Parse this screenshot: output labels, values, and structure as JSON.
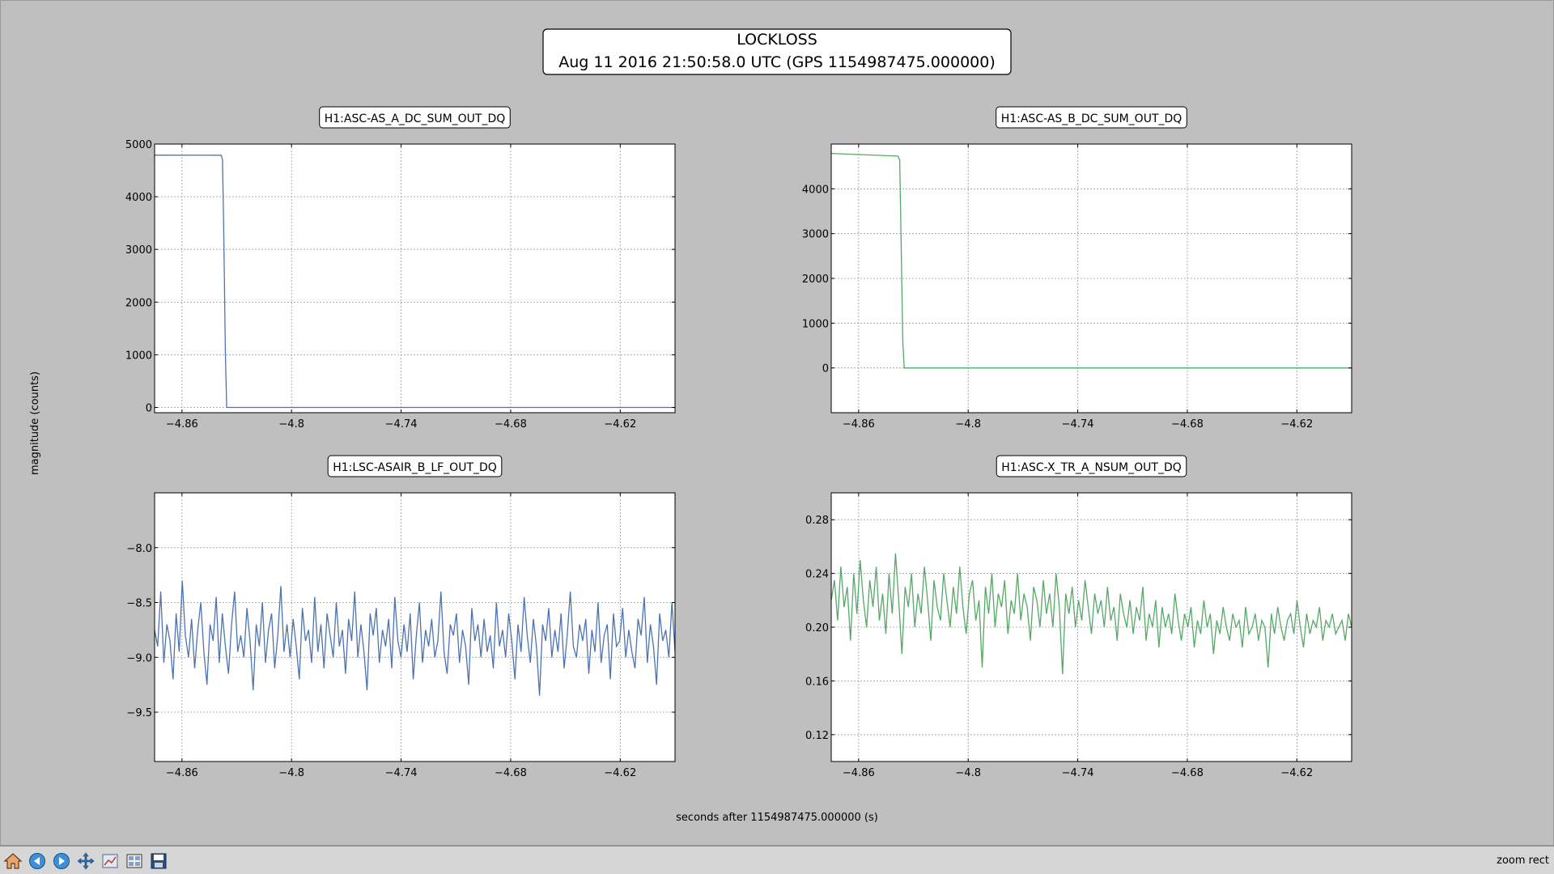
{
  "figure": {
    "title_line1": "LOCKLOSS",
    "title_line2": "Aug 11 2016 21:50:58.0 UTC (GPS 1154987475.000000)",
    "xlabel": "seconds after 1154987475.000000 (s)",
    "ylabel": "magnitude (counts)"
  },
  "toolbar": {
    "buttons": [
      "home-icon",
      "back-icon",
      "forward-icon",
      "pan-icon",
      "subplots-icon",
      "configure-icon",
      "save-icon"
    ],
    "status": "zoom rect"
  },
  "chart_data": [
    {
      "type": "line",
      "title": "H1:ASC-AS_A_DC_SUM_OUT_DQ",
      "xlim": [
        -4.875,
        -4.59
      ],
      "ylim": [
        -100,
        5000
      ],
      "xticks": [
        -4.86,
        -4.8,
        -4.74,
        -4.68,
        -4.62
      ],
      "xtick_labels": [
        "−4.86",
        "−4.8",
        "−4.74",
        "−4.68",
        "−4.62"
      ],
      "yticks": [
        0,
        1000,
        2000,
        3000,
        4000,
        5000
      ],
      "ytick_labels": [
        "0",
        "1000",
        "2000",
        "3000",
        "4000",
        "5000"
      ],
      "grid": true,
      "color": "#4c72b0",
      "series": [
        {
          "x": [
            -4.875,
            -4.8385,
            -4.8378,
            -4.8372,
            -4.8362,
            -4.8355,
            -4.59
          ],
          "y": [
            4790,
            4788,
            4700,
            3500,
            1000,
            0,
            0
          ]
        }
      ]
    },
    {
      "type": "line",
      "title": "H1:ASC-AS_B_DC_SUM_OUT_DQ",
      "xlim": [
        -4.875,
        -4.59
      ],
      "ylim": [
        -1000,
        5000
      ],
      "xticks": [
        -4.86,
        -4.8,
        -4.74,
        -4.68,
        -4.62
      ],
      "xtick_labels": [
        "−4.86",
        "−4.8",
        "−4.74",
        "−4.68",
        "−4.62"
      ],
      "yticks": [
        0,
        1000,
        2000,
        3000,
        4000
      ],
      "ytick_labels": [
        "0",
        "1000",
        "2000",
        "3000",
        "4000"
      ],
      "grid": true,
      "color": "#55a868",
      "series": [
        {
          "x": [
            -4.875,
            -4.8385,
            -4.8375,
            -4.8368,
            -4.8358,
            -4.835,
            -4.59
          ],
          "y": [
            4790,
            4730,
            4650,
            3000,
            600,
            0,
            0
          ]
        }
      ]
    },
    {
      "type": "line",
      "title": "H1:LSC-ASAIR_B_LF_OUT_DQ",
      "xlim": [
        -4.875,
        -4.59
      ],
      "ylim": [
        -9.95,
        -7.5
      ],
      "xticks": [
        -4.86,
        -4.8,
        -4.74,
        -4.68,
        -4.62
      ],
      "xtick_labels": [
        "−4.86",
        "−4.8",
        "−4.74",
        "−4.68",
        "−4.62"
      ],
      "yticks": [
        -9.5,
        -9.0,
        -8.5,
        -8.0
      ],
      "ytick_labels": [
        "−9.5",
        "−9.0",
        "−8.5",
        "−8.0"
      ],
      "grid": true,
      "color": "#4c72b0",
      "series": [
        {
          "x_start": -4.875,
          "x_end": -4.59,
          "y": [
            -8.75,
            -8.9,
            -8.4,
            -9.05,
            -8.7,
            -8.85,
            -9.2,
            -8.6,
            -8.95,
            -8.3,
            -8.8,
            -9.0,
            -8.65,
            -9.1,
            -8.75,
            -8.5,
            -8.95,
            -9.25,
            -8.7,
            -8.85,
            -8.45,
            -9.05,
            -8.6,
            -8.9,
            -9.15,
            -8.7,
            -8.4,
            -8.95,
            -8.8,
            -9.0,
            -8.55,
            -8.85,
            -9.3,
            -8.7,
            -8.9,
            -8.5,
            -9.05,
            -8.75,
            -8.6,
            -9.1,
            -8.8,
            -8.35,
            -8.95,
            -8.7,
            -9.0,
            -8.65,
            -8.9,
            -9.2,
            -8.55,
            -8.85,
            -8.75,
            -9.05,
            -8.45,
            -8.95,
            -8.7,
            -9.1,
            -8.6,
            -8.8,
            -9.0,
            -8.5,
            -8.9,
            -8.75,
            -9.15,
            -8.65,
            -8.85,
            -8.4,
            -9.0,
            -8.7,
            -8.95,
            -9.3,
            -8.6,
            -8.8,
            -8.55,
            -9.05,
            -8.75,
            -8.9,
            -8.65,
            -9.1,
            -8.45,
            -8.85,
            -9.0,
            -8.7,
            -8.95,
            -8.6,
            -9.2,
            -8.8,
            -8.5,
            -9.05,
            -8.75,
            -8.9,
            -8.65,
            -9.0,
            -8.85,
            -8.4,
            -8.95,
            -9.15,
            -8.7,
            -8.8,
            -8.6,
            -9.05,
            -8.75,
            -8.9,
            -9.25,
            -8.55,
            -8.85,
            -8.7,
            -9.0,
            -8.65,
            -8.95,
            -8.8,
            -9.1,
            -8.5,
            -8.9,
            -8.75,
            -9.0,
            -8.6,
            -8.85,
            -9.2,
            -8.7,
            -8.95,
            -8.45,
            -8.8,
            -9.05,
            -8.65,
            -8.9,
            -9.35,
            -8.7,
            -8.85,
            -8.55,
            -9.0,
            -8.75,
            -8.95,
            -8.6,
            -9.1,
            -8.8,
            -8.4,
            -8.9,
            -9.0,
            -8.7,
            -8.85,
            -8.65,
            -9.15,
            -8.75,
            -8.95,
            -8.5,
            -9.05,
            -8.8,
            -8.7,
            -9.2,
            -8.6,
            -8.9,
            -8.85,
            -8.55,
            -9.0,
            -8.75,
            -8.95,
            -9.1,
            -8.65,
            -8.8,
            -8.45,
            -9.05,
            -8.7,
            -8.9,
            -9.25,
            -8.6,
            -8.85,
            -8.75,
            -9.0,
            -8.5,
            -8.95
          ]
        }
      ]
    },
    {
      "type": "line",
      "title": "H1:ASC-X_TR_A_NSUM_OUT_DQ",
      "xlim": [
        -4.875,
        -4.59
      ],
      "ylim": [
        0.1,
        0.3
      ],
      "xticks": [
        -4.86,
        -4.8,
        -4.74,
        -4.68,
        -4.62
      ],
      "xtick_labels": [
        "−4.86",
        "−4.8",
        "−4.74",
        "−4.68",
        "−4.62"
      ],
      "yticks": [
        0.12,
        0.16,
        0.2,
        0.24,
        0.28
      ],
      "ytick_labels": [
        "0.12",
        "0.16",
        "0.20",
        "0.24",
        "0.28"
      ],
      "grid": true,
      "color": "#55a868",
      "series": [
        {
          "x_start": -4.875,
          "x_end": -4.59,
          "y": [
            0.22,
            0.235,
            0.205,
            0.245,
            0.215,
            0.23,
            0.19,
            0.24,
            0.21,
            0.25,
            0.22,
            0.2,
            0.235,
            0.215,
            0.245,
            0.205,
            0.225,
            0.195,
            0.24,
            0.21,
            0.255,
            0.22,
            0.18,
            0.23,
            0.215,
            0.24,
            0.2,
            0.225,
            0.21,
            0.245,
            0.22,
            0.19,
            0.235,
            0.215,
            0.205,
            0.24,
            0.22,
            0.2,
            0.23,
            0.21,
            0.245,
            0.215,
            0.195,
            0.225,
            0.235,
            0.205,
            0.22,
            0.17,
            0.23,
            0.21,
            0.24,
            0.2,
            0.225,
            0.215,
            0.235,
            0.195,
            0.22,
            0.21,
            0.24,
            0.205,
            0.225,
            0.215,
            0.19,
            0.23,
            0.22,
            0.2,
            0.235,
            0.21,
            0.225,
            0.2,
            0.24,
            0.215,
            0.165,
            0.225,
            0.21,
            0.23,
            0.2,
            0.22,
            0.205,
            0.235,
            0.215,
            0.195,
            0.225,
            0.21,
            0.22,
            0.2,
            0.23,
            0.205,
            0.215,
            0.19,
            0.225,
            0.21,
            0.2,
            0.22,
            0.195,
            0.215,
            0.205,
            0.23,
            0.19,
            0.21,
            0.2,
            0.22,
            0.185,
            0.215,
            0.2,
            0.21,
            0.195,
            0.225,
            0.205,
            0.19,
            0.21,
            0.2,
            0.215,
            0.185,
            0.205,
            0.195,
            0.22,
            0.2,
            0.21,
            0.18,
            0.205,
            0.195,
            0.215,
            0.2,
            0.19,
            0.21,
            0.2,
            0.205,
            0.185,
            0.215,
            0.195,
            0.2,
            0.21,
            0.19,
            0.205,
            0.2,
            0.17,
            0.21,
            0.195,
            0.215,
            0.2,
            0.19,
            0.205,
            0.21,
            0.195,
            0.22,
            0.2,
            0.185,
            0.21,
            0.195,
            0.205,
            0.2,
            0.215,
            0.19,
            0.205,
            0.2,
            0.21,
            0.195,
            0.2,
            0.205,
            0.19,
            0.21,
            0.2
          ]
        }
      ]
    }
  ]
}
